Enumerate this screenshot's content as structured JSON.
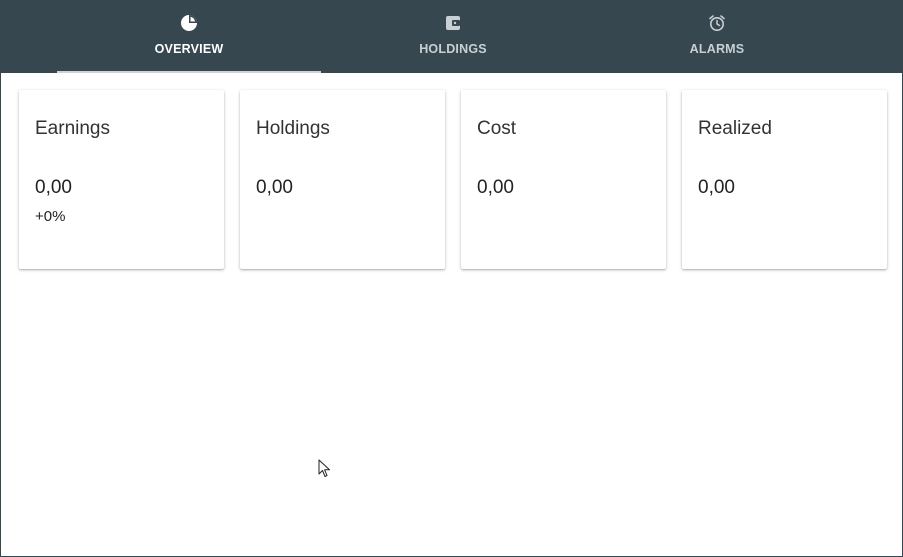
{
  "tabs": [
    {
      "label": "OVERVIEW",
      "icon": "pie-chart-icon",
      "active": true
    },
    {
      "label": "HOLDINGS",
      "icon": "wallet-icon",
      "active": false
    },
    {
      "label": "ALARMS",
      "icon": "alarm-clock-icon",
      "active": false
    }
  ],
  "cards": [
    {
      "title": "Earnings",
      "value": "0,00",
      "change": "+0%"
    },
    {
      "title": "Holdings",
      "value": "0,00"
    },
    {
      "title": "Cost",
      "value": "0,00"
    },
    {
      "title": "Realized",
      "value": "0,00"
    }
  ],
  "colors": {
    "header_bg": "#37474f",
    "tab_active_text": "#ffffff",
    "tab_inactive_text": "#c9d0d4",
    "tab_indicator": "#cfd4d6"
  }
}
